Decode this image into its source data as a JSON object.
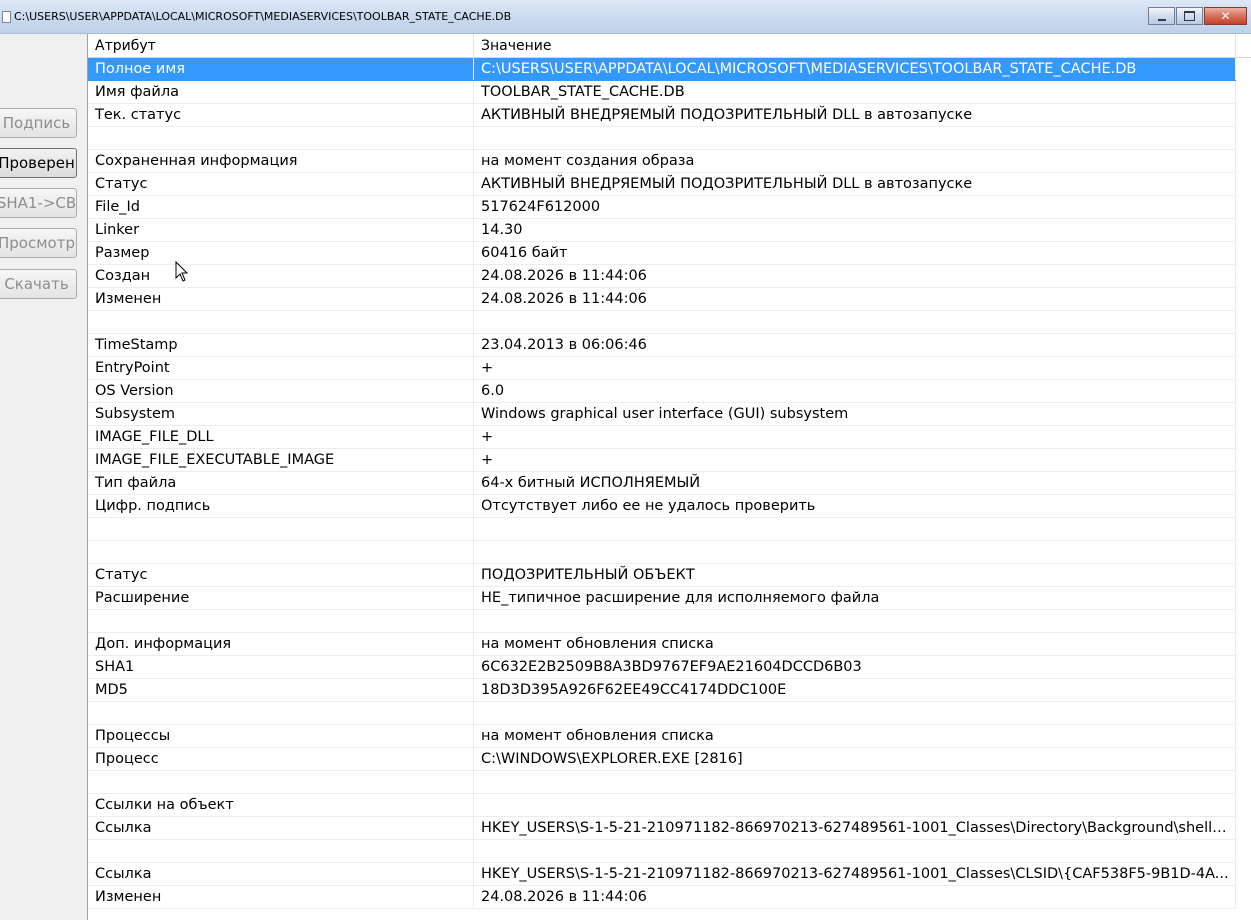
{
  "window": {
    "title": "C:\\USERS\\USER\\APPDATA\\LOCAL\\MICROSOFT\\MEDIASERVICES\\TOOLBAR_STATE_CACHE.DB",
    "controls": [
      "minimize-icon",
      "maximize-icon",
      "close-icon"
    ]
  },
  "sidebar": {
    "buttons": [
      {
        "label": "Подпись",
        "enabled": false
      },
      {
        "label": "Проверен",
        "enabled": true
      },
      {
        "label": "SHA1->CB",
        "enabled": false
      },
      {
        "label": "Просмотр",
        "enabled": false
      },
      {
        "label": "Скачать",
        "enabled": false
      }
    ]
  },
  "grid": {
    "columns": [
      "Атрибут",
      "Значение"
    ],
    "selected_row": 0,
    "rows": [
      {
        "attr": "Полное имя",
        "value": "C:\\USERS\\USER\\APPDATA\\LOCAL\\MICROSOFT\\MEDIASERVICES\\TOOLBAR_STATE_CACHE.DB"
      },
      {
        "attr": "Имя файла",
        "value": "TOOLBAR_STATE_CACHE.DB"
      },
      {
        "attr": "Тек. статус",
        "value": "АКТИВНЫЙ ВНЕДРЯЕМЫЙ ПОДОЗРИТЕЛЬНЫЙ DLL в автозапуске"
      },
      {
        "attr": "",
        "value": ""
      },
      {
        "attr": "Сохраненная информация",
        "value": "на момент создания образа"
      },
      {
        "attr": "Статус",
        "value": "АКТИВНЫЙ ВНЕДРЯЕМЫЙ ПОДОЗРИТЕЛЬНЫЙ DLL в автозапуске"
      },
      {
        "attr": "File_Id",
        "value": "517624F612000"
      },
      {
        "attr": "Linker",
        "value": "14.30"
      },
      {
        "attr": "Размер",
        "value": "60416 байт"
      },
      {
        "attr": "Создан",
        "value": "24.08.2026 в 11:44:06"
      },
      {
        "attr": "Изменен",
        "value": "24.08.2026 в 11:44:06"
      },
      {
        "attr": "",
        "value": ""
      },
      {
        "attr": "TimeStamp",
        "value": "23.04.2013 в 06:06:46"
      },
      {
        "attr": "EntryPoint",
        "value": "+"
      },
      {
        "attr": "OS Version",
        "value": "6.0"
      },
      {
        "attr": "Subsystem",
        "value": "Windows graphical user interface (GUI) subsystem"
      },
      {
        "attr": "IMAGE_FILE_DLL",
        "value": "+"
      },
      {
        "attr": "IMAGE_FILE_EXECUTABLE_IMAGE",
        "value": "+"
      },
      {
        "attr": "Тип файла",
        "value": "64-х битный ИСПОЛНЯЕМЫЙ"
      },
      {
        "attr": "Цифр. подпись",
        "value": "Отсутствует либо ее не удалось проверить"
      },
      {
        "attr": "",
        "value": ""
      },
      {
        "attr": "",
        "value": ""
      },
      {
        "attr": "Статус",
        "value": "ПОДОЗРИТЕЛЬНЫЙ ОБЪЕКТ"
      },
      {
        "attr": "Расширение",
        "value": "НЕ_типичное расширение для исполняемого файла"
      },
      {
        "attr": "",
        "value": ""
      },
      {
        "attr": "Доп. информация",
        "value": "на момент обновления списка"
      },
      {
        "attr": "SHA1",
        "value": "6C632E2B2509B8A3BD9767EF9AE21604DCCD6B03"
      },
      {
        "attr": "MD5",
        "value": "18D3D395A926F62EE49CC4174DDC100E"
      },
      {
        "attr": "",
        "value": ""
      },
      {
        "attr": "Процессы",
        "value": "на момент обновления списка"
      },
      {
        "attr": "Процесс",
        "value": "C:\\WINDOWS\\EXPLORER.EXE [2816]"
      },
      {
        "attr": "",
        "value": ""
      },
      {
        "attr": "Ссылки на объект",
        "value": ""
      },
      {
        "attr": "Ссылка",
        "value": "HKEY_USERS\\S-1-5-21-210971182-866970213-627489561-1001_Classes\\Directory\\Background\\shelle..."
      },
      {
        "attr": "",
        "value": ""
      },
      {
        "attr": "Ссылка",
        "value": "HKEY_USERS\\S-1-5-21-210971182-866970213-627489561-1001_Classes\\CLSID\\{CAF538F5-9B1D-4A..."
      },
      {
        "attr": "Изменен",
        "value": "24.08.2026 в 11:44:06"
      }
    ]
  }
}
